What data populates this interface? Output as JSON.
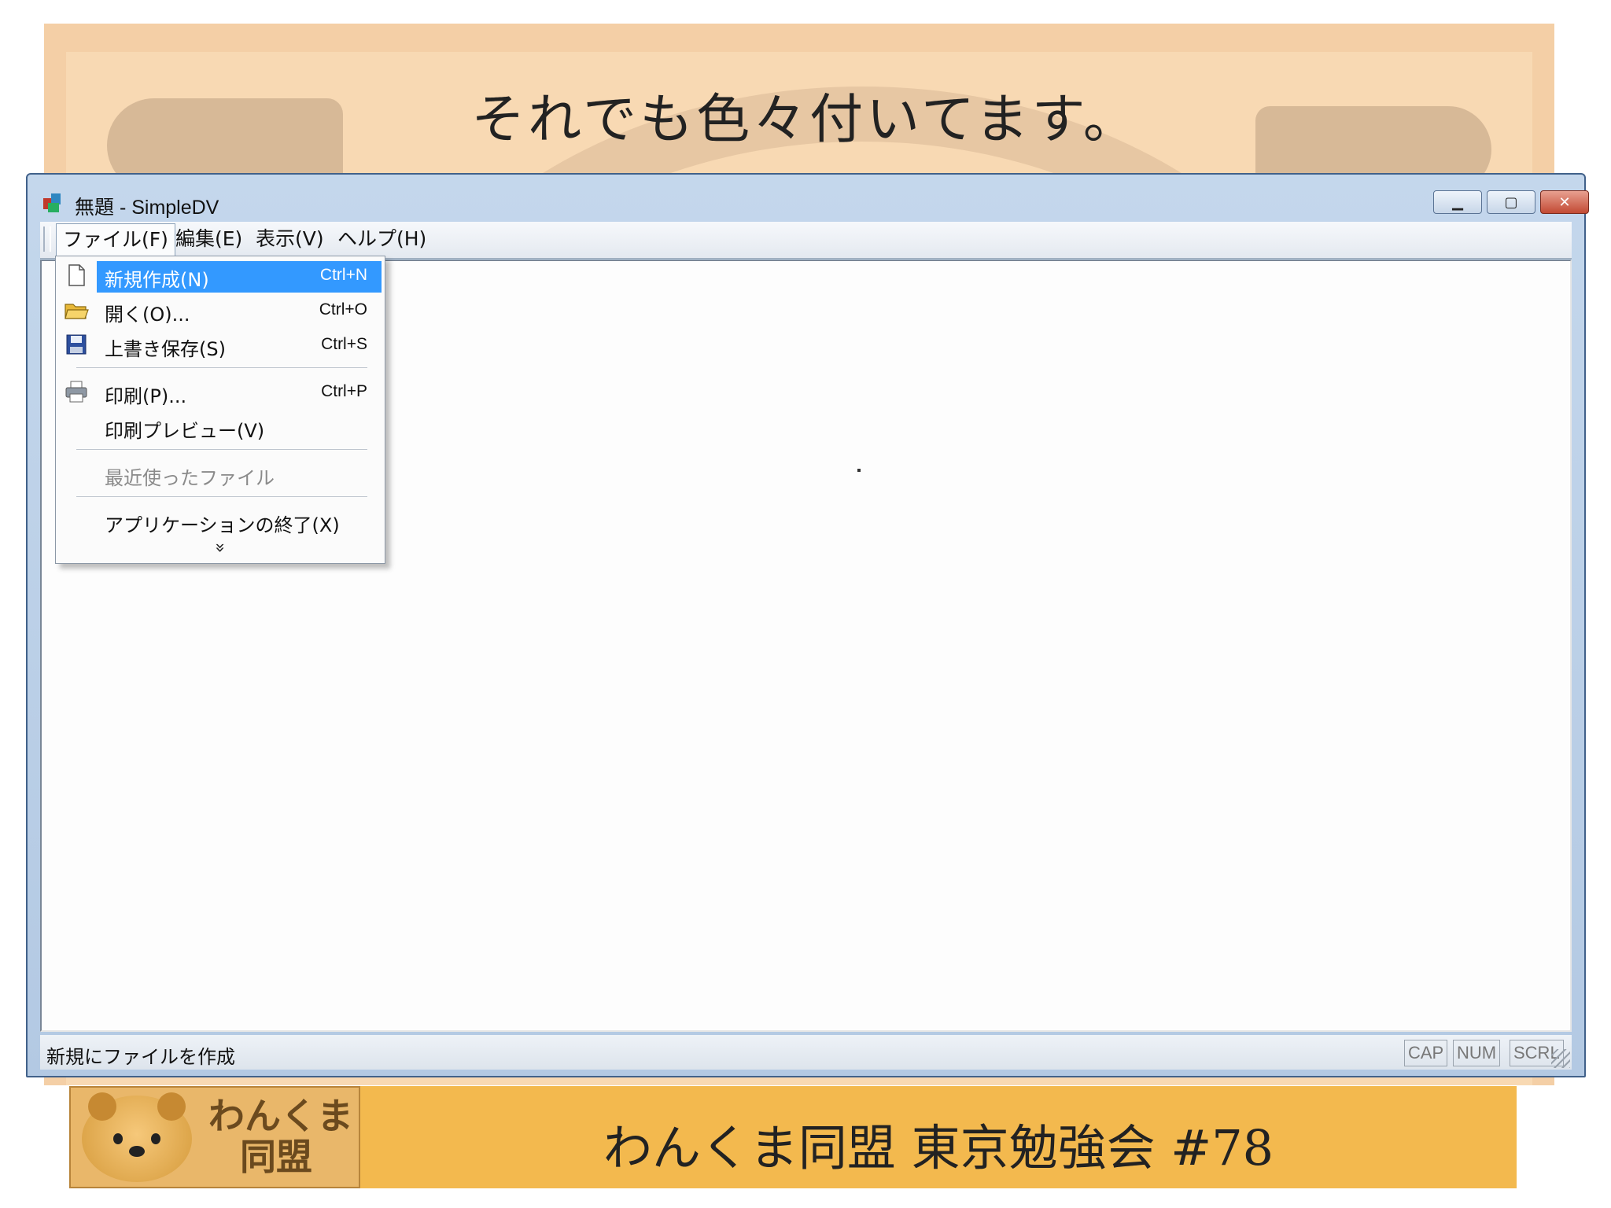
{
  "slide": {
    "title": "それでも色々付いてます。",
    "footer_title": "わんくま同盟 東京勉強会 #78",
    "logo_line1": "わんくま",
    "logo_line2": "同盟"
  },
  "window": {
    "title": "無題 - SimpleDV",
    "minimize_icon": "minimize-icon",
    "maximize_icon": "maximize-icon",
    "close_icon": "close-icon"
  },
  "menubar": {
    "file": "ファイル(F)",
    "edit": "編集(E)",
    "view": "表示(V)",
    "help": "ヘルプ(H)"
  },
  "file_menu": {
    "items": [
      {
        "label": "新規作成(N)",
        "shortcut": "Ctrl+N",
        "icon": "new-file-icon"
      },
      {
        "label": "開く(O)...",
        "shortcut": "Ctrl+O",
        "icon": "open-folder-icon"
      },
      {
        "label": "上書き保存(S)",
        "shortcut": "Ctrl+S",
        "icon": "save-icon"
      },
      {
        "label": "印刷(P)...",
        "shortcut": "Ctrl+P",
        "icon": "printer-icon"
      },
      {
        "label": "印刷プレビュー(V)",
        "shortcut": ""
      },
      {
        "label": "最近使ったファイル",
        "shortcut": ""
      },
      {
        "label": "アプリケーションの終了(X)",
        "shortcut": ""
      }
    ],
    "expand_glyph": "»"
  },
  "statusbar": {
    "text": "新規にファイルを作成",
    "cap": "CAP",
    "num": "NUM",
    "scrl": "SCRL"
  },
  "colors": {
    "selection": "#3399ff",
    "slide_background": "#f8d9b3",
    "footer_band": "#f3b94e"
  }
}
